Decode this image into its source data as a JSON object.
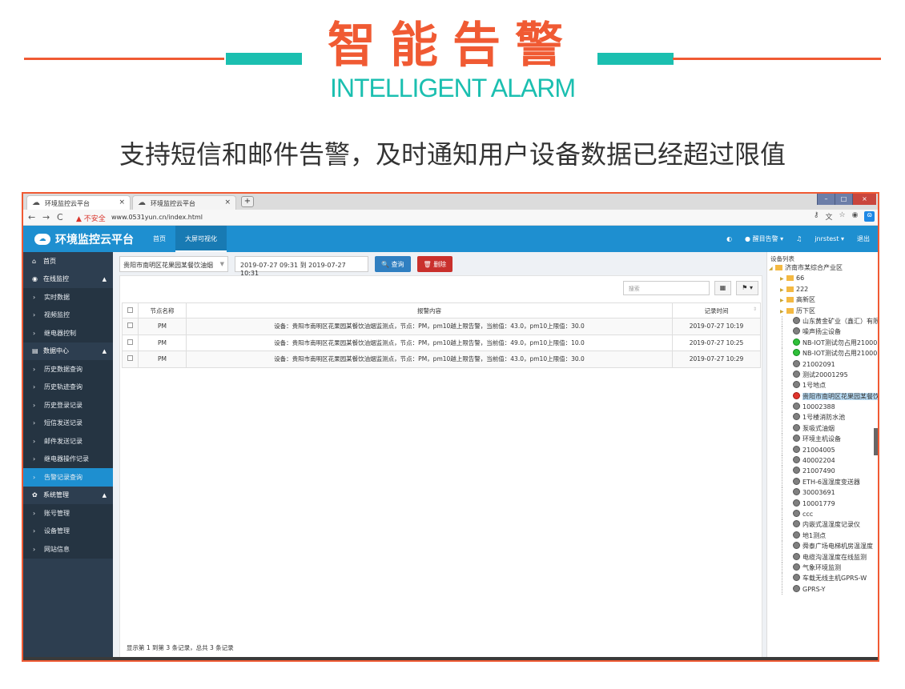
{
  "promo": {
    "title": "智能告警",
    "subtitle": "INTELLIGENT ALARM",
    "description": "支持短信和邮件告警，及时通知用户设备数据已经超过限值"
  },
  "browser": {
    "tabs": [
      {
        "label": "环境监控云平台"
      },
      {
        "label": "环境监控云平台"
      }
    ],
    "new_tab": "+",
    "security_label": "不安全",
    "url": "www.0531yun.cn/index.html"
  },
  "app": {
    "logo_text": "环境监控云平台",
    "topnav": [
      {
        "label": "首页"
      },
      {
        "label": "大屏可视化"
      }
    ],
    "alarm_label": "醒目告警",
    "user": "jnrstest",
    "logout": "退出"
  },
  "sidebar": {
    "items": [
      {
        "label": "首页",
        "icon": "home-icon",
        "type": "group"
      },
      {
        "label": "在线监控",
        "icon": "monitor-icon",
        "type": "group",
        "caret": "▲"
      },
      {
        "label": "实时数据",
        "type": "sub"
      },
      {
        "label": "视频监控",
        "type": "sub"
      },
      {
        "label": "继电器控制",
        "type": "sub"
      },
      {
        "label": "数据中心",
        "icon": "calendar-icon",
        "type": "group",
        "caret": "▲"
      },
      {
        "label": "历史数据查询",
        "type": "sub"
      },
      {
        "label": "历史轨迹查询",
        "type": "sub"
      },
      {
        "label": "历史登录记录",
        "type": "sub"
      },
      {
        "label": "短信发送记录",
        "type": "sub"
      },
      {
        "label": "邮件发送记录",
        "type": "sub"
      },
      {
        "label": "继电器操作记录",
        "type": "sub"
      },
      {
        "label": "告警记录查询",
        "type": "sub",
        "active": true
      },
      {
        "label": "系统管理",
        "icon": "gear-icon",
        "type": "group",
        "caret": "▲"
      },
      {
        "label": "账号管理",
        "type": "sub"
      },
      {
        "label": "设备管理",
        "type": "sub"
      },
      {
        "label": "网站信息",
        "type": "sub"
      }
    ]
  },
  "filter": {
    "device_select": "贵阳市南明区花果园某餐饮油烟",
    "date_range": "2019-07-27 09:31 到 2019-07-27 10:31",
    "query_button": "查询",
    "delete_button": "删除"
  },
  "table": {
    "search_placeholder": "搜索",
    "columns": [
      "节点名称",
      "报警内容",
      "记录时间"
    ],
    "rows": [
      {
        "node": "PM",
        "content": "设备：贵阳市南明区花果园某餐饮油烟监测点，节点：PM，pm10越上限告警，当前值：43.0，pm10上限值：30.0",
        "time": "2019-07-27 10:19"
      },
      {
        "node": "PM",
        "content": "设备：贵阳市南明区花果园某餐饮油烟监测点，节点：PM，pm10越上限告警，当前值：49.0，pm10上限值：10.0",
        "time": "2019-07-27 10:25"
      },
      {
        "node": "PM",
        "content": "设备：贵阳市南明区花果园某餐饮油烟监测点，节点：PM，pm10越上限告警，当前值：43.0，pm10上限值：30.0",
        "time": "2019-07-27 10:29"
      }
    ],
    "footer": "显示第 1 到第 3 条记录，总共 3 条记录"
  },
  "tree": {
    "title": "设备列表",
    "root": "济南市某综合产业区",
    "folders": [
      "66",
      "222",
      "高新区",
      "历下区"
    ],
    "devices": [
      {
        "label": "山东黄金矿业（鑫汇）有限",
        "status": "gray"
      },
      {
        "label": "噪声扬尘设备",
        "status": "gray"
      },
      {
        "label": "NB-IOT测试勿占用21000",
        "status": "green"
      },
      {
        "label": "NB-IOT测试勿占用21000",
        "status": "green"
      },
      {
        "label": "21002091",
        "status": "gray"
      },
      {
        "label": "测试20001295",
        "status": "gray"
      },
      {
        "label": "1号地点",
        "status": "gray"
      },
      {
        "label": "贵阳市南明区花果园某餐饮",
        "status": "red",
        "selected": true
      },
      {
        "label": "10002388",
        "status": "gray"
      },
      {
        "label": "1号楼消防水池",
        "status": "gray"
      },
      {
        "label": "泵吸式油烟",
        "status": "gray"
      },
      {
        "label": "环境主机设备",
        "status": "gray"
      },
      {
        "label": "21004005",
        "status": "gray"
      },
      {
        "label": "40002204",
        "status": "gray"
      },
      {
        "label": "21007490",
        "status": "gray"
      },
      {
        "label": "ETH-6温湿度变送器",
        "status": "gray"
      },
      {
        "label": "30003691",
        "status": "gray"
      },
      {
        "label": "10001779",
        "status": "gray"
      },
      {
        "label": "ccc",
        "status": "gray"
      },
      {
        "label": "内嵌式温湿度记录仪",
        "status": "gray"
      },
      {
        "label": "地1测点",
        "status": "gray"
      },
      {
        "label": "舜泰广场电梯机房温湿度",
        "status": "gray"
      },
      {
        "label": "电缆沟温湿度在线监测",
        "status": "gray"
      },
      {
        "label": "气象环境监测",
        "status": "gray"
      },
      {
        "label": "车载无线主机GPRS-W",
        "status": "gray"
      },
      {
        "label": "GPRS-Y",
        "status": "gray"
      }
    ]
  },
  "colors": {
    "accent_orange": "#f05a33",
    "accent_teal": "#1bbfb0",
    "app_blue": "#1e8fd0",
    "sidebar_bg": "#2d3e50"
  }
}
